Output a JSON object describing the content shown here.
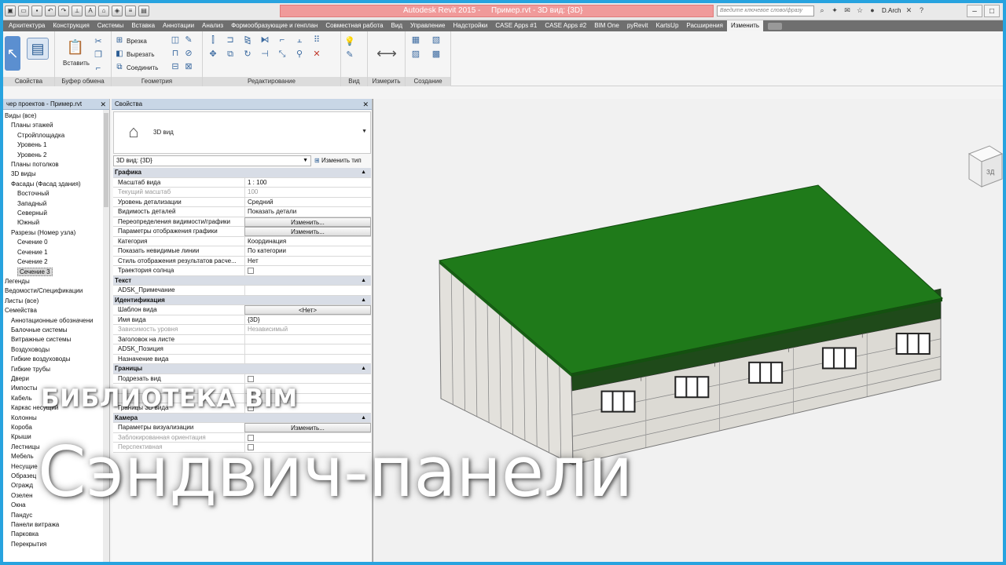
{
  "titlebar": {
    "app_title": "Autodesk Revit 2015 -",
    "doc_title": "Пример.rvt - 3D вид: {3D}",
    "search_placeholder": "Введите ключевое слово/фразу",
    "user": "D.Arch"
  },
  "tabs": [
    "Архитектура",
    "Конструкция",
    "Системы",
    "Вставка",
    "Аннотации",
    "Анализ",
    "Формообразующие и генплан",
    "Совместная работа",
    "Вид",
    "Управление",
    "Надстройки",
    "CASE Apps #1",
    "CASE Apps #2",
    "BIM One",
    "pyRevit",
    "KartsUp",
    "Расширения",
    "Изменить"
  ],
  "active_tab": "Изменить",
  "ribbon": {
    "panels": {
      "properties": "Свойства",
      "clipboard": "Буфер обмена",
      "geometry": "Геометрия",
      "modify": "Редактирование",
      "view": "Вид",
      "measure": "Измерить",
      "create": "Создание"
    },
    "paste_label": "Вставить",
    "cut_label": "Врезка",
    "cut2_label": "Вырезать",
    "join_label": "Соединить"
  },
  "browser": {
    "title": "чер проектов - Пример.rvt",
    "items": [
      {
        "label": "Виды (все)",
        "indent": 0
      },
      {
        "label": "Планы этажей",
        "indent": 1
      },
      {
        "label": "Стройплощадка",
        "indent": 2
      },
      {
        "label": "Уровень 1",
        "indent": 2
      },
      {
        "label": "Уровень 2",
        "indent": 2
      },
      {
        "label": "Планы потолков",
        "indent": 1
      },
      {
        "label": "3D виды",
        "indent": 1
      },
      {
        "label": "Фасады (Фасад здания)",
        "indent": 1
      },
      {
        "label": "Восточный",
        "indent": 2
      },
      {
        "label": "Западный",
        "indent": 2
      },
      {
        "label": "Северный",
        "indent": 2
      },
      {
        "label": "Южный",
        "indent": 2
      },
      {
        "label": "Разрезы (Номер узла)",
        "indent": 1
      },
      {
        "label": "Сечение 0",
        "indent": 2
      },
      {
        "label": "Сечение 1",
        "indent": 2
      },
      {
        "label": "Сечение 2",
        "indent": 2
      },
      {
        "label": "Сечение 3",
        "indent": 2,
        "selected": true
      },
      {
        "label": "Легенды",
        "indent": 0
      },
      {
        "label": "Ведомости/Спецификации",
        "indent": 0
      },
      {
        "label": "Листы (все)",
        "indent": 0
      },
      {
        "label": "Семейства",
        "indent": 0
      },
      {
        "label": "Аннотационные обозначени",
        "indent": 1
      },
      {
        "label": "Балочные системы",
        "indent": 1
      },
      {
        "label": "Витражные системы",
        "indent": 1
      },
      {
        "label": "Воздуховоды",
        "indent": 1
      },
      {
        "label": "Гибкие воздуховоды",
        "indent": 1
      },
      {
        "label": "Гибкие трубы",
        "indent": 1
      },
      {
        "label": "Двери",
        "indent": 1
      },
      {
        "label": "Импосты",
        "indent": 1
      },
      {
        "label": "Кабель",
        "indent": 1
      },
      {
        "label": "Каркас несущий",
        "indent": 1
      },
      {
        "label": "Колонны",
        "indent": 1
      },
      {
        "label": "Короба",
        "indent": 1
      },
      {
        "label": "Крыши",
        "indent": 1
      },
      {
        "label": "Лестницы",
        "indent": 1
      },
      {
        "label": "Мебель",
        "indent": 1
      },
      {
        "label": "Несущие",
        "indent": 1
      },
      {
        "label": "Образец",
        "indent": 1
      },
      {
        "label": "Огражд",
        "indent": 1
      },
      {
        "label": "Озелен",
        "indent": 1
      },
      {
        "label": "Окна",
        "indent": 1
      },
      {
        "label": "Пандус",
        "indent": 1
      },
      {
        "label": "Панели витража",
        "indent": 1
      },
      {
        "label": "Парковка",
        "indent": 1
      },
      {
        "label": "Перекрытия",
        "indent": 1
      }
    ]
  },
  "properties": {
    "title": "Свойства",
    "type_name": "3D вид",
    "instance_select": "3D вид: {3D}",
    "edit_type": "Изменить тип",
    "rows": [
      {
        "kind": "group",
        "name": "Графика"
      },
      {
        "name": "Масштаб вида",
        "value": "1 : 100"
      },
      {
        "name": "Текущий масштаб",
        "value": "100",
        "disabled": true
      },
      {
        "name": "Уровень детализации",
        "value": "Средний"
      },
      {
        "name": "Видимость деталей",
        "value": "Показать детали"
      },
      {
        "name": "Переопределения видимости/графики",
        "value": "Изменить...",
        "button": true
      },
      {
        "name": "Параметры отображения графики",
        "value": "Изменить...",
        "button": true
      },
      {
        "name": "Категория",
        "value": "Координация"
      },
      {
        "name": "Показать невидимые линии",
        "value": "По категории"
      },
      {
        "name": "Стиль отображения результатов расче...",
        "value": "Нет"
      },
      {
        "name": "Траектория солнца",
        "value": "",
        "check": true
      },
      {
        "kind": "group",
        "name": "Текст"
      },
      {
        "name": "ADSK_Примечание",
        "value": ""
      },
      {
        "kind": "group",
        "name": "Идентификация"
      },
      {
        "name": "Шаблон вида",
        "value": "<Нет>",
        "button": true
      },
      {
        "name": "Имя вида",
        "value": "{3D}"
      },
      {
        "name": "Зависимость уровня",
        "value": "Независимый",
        "disabled": true
      },
      {
        "name": "Заголовок на листе",
        "value": ""
      },
      {
        "name": "ADSK_Позиция",
        "value": ""
      },
      {
        "name": "Назначение вида",
        "value": ""
      },
      {
        "kind": "group",
        "name": "Границы"
      },
      {
        "name": "Подрезать вид",
        "value": "",
        "check": true
      },
      {
        "name": "",
        "value": ""
      },
      {
        "name": "",
        "value": ""
      },
      {
        "name": "Границы 3D вида",
        "value": "",
        "check": true
      },
      {
        "kind": "group",
        "name": "Камера"
      },
      {
        "name": "Параметры визуализации",
        "value": "Изменить...",
        "button": true
      },
      {
        "name": "Заблокированная ориентация",
        "value": "",
        "check": true,
        "disabled": true
      },
      {
        "name": "Перспективная",
        "value": "",
        "check": true,
        "disabled": true
      }
    ]
  },
  "overlay": {
    "channel": "БИБЛИОТЕКА BIM",
    "headline": "Сэндвич-панели"
  },
  "colors": {
    "roof": "#1f7a1a",
    "accent_frame": "#27a3df",
    "title_highlight": "#f09a9a"
  }
}
